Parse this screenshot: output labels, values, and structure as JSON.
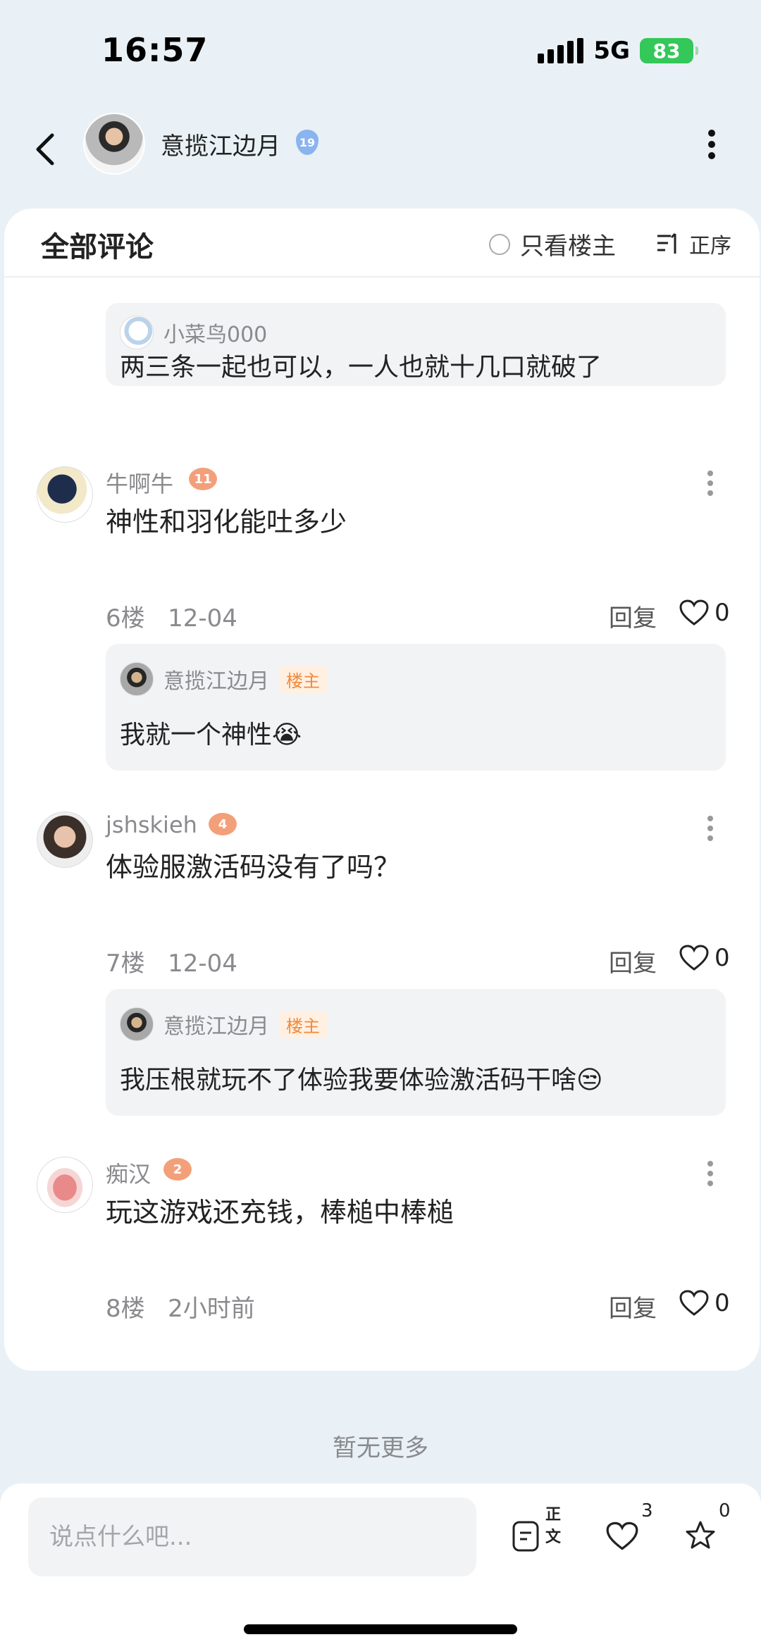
{
  "status": {
    "time": "16:57",
    "network": "5G",
    "battery": "83"
  },
  "header": {
    "user_name": "意揽江边月",
    "level": "19"
  },
  "comments_header": {
    "title": "全部评论",
    "only_owner_label": "只看楼主",
    "sort_label": "正序"
  },
  "top_reply": {
    "name": "小菜鸟000",
    "text": "两三条一起也可以，一人也就十几口就破了"
  },
  "comments": [
    {
      "name": "牛啊牛",
      "badge": "11",
      "text": "神性和羽化能吐多少",
      "floor": "6楼",
      "date": "12-04",
      "reply_label": "回复",
      "likes": "0",
      "reply": {
        "name": "意揽江边月",
        "tag": "楼主",
        "text": "我就一个神性😭"
      }
    },
    {
      "name": "jshskieh",
      "badge": "4",
      "text": "体验服激活码没有了吗？",
      "floor": "7楼",
      "date": "12-04",
      "reply_label": "回复",
      "likes": "0",
      "reply": {
        "name": "意揽江边月",
        "tag": "楼主",
        "text": "我压根就玩不了体验我要体验激活码干啥😒"
      }
    },
    {
      "name": "痴汉",
      "badge": "2",
      "text": "玩这游戏还充钱，棒槌中棒槌",
      "floor": "8楼",
      "date": "2小时前",
      "reply_label": "回复",
      "likes": "0"
    }
  ],
  "footer": {
    "no_more": "暂无更多",
    "input_placeholder": "说点什么吧...",
    "text_label": "正文",
    "like_count": "3",
    "star_count": "0"
  },
  "colors": {
    "accent_orange": "#f08a3c",
    "battery_green": "#34c759",
    "level_blue": "#8ab4ef"
  }
}
